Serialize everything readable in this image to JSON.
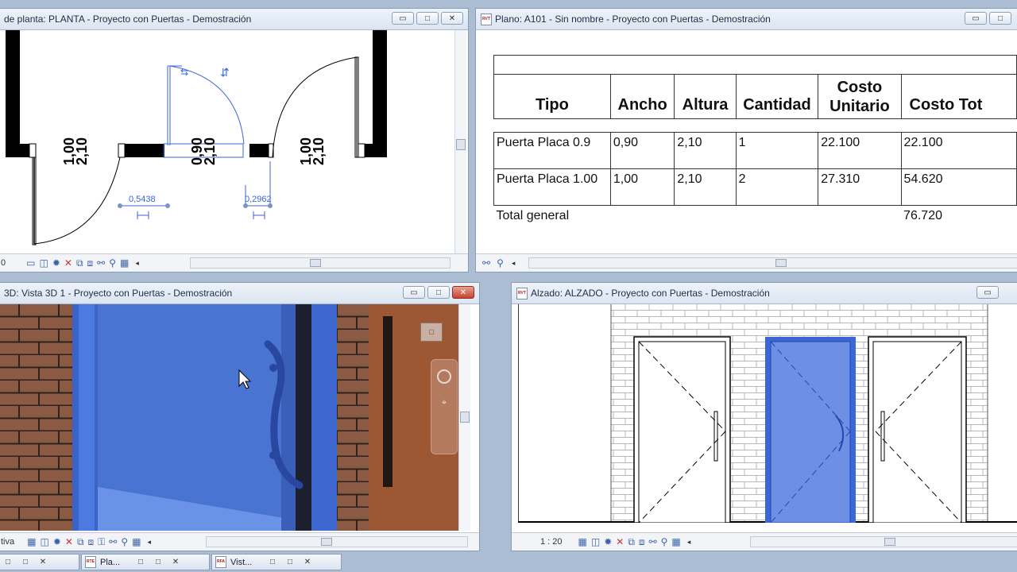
{
  "windows": {
    "planta": {
      "title": "de planta: PLANTA - Proyecto con Puertas - Demostración",
      "dims": {
        "w1": "1,00",
        "h1": "2,10",
        "w2": "0,90",
        "h2": "2,10",
        "w3": "1,00",
        "h3": "2,10",
        "d1": "0,5438",
        "d2": "0,2962"
      },
      "status_scale": "0"
    },
    "plano": {
      "title": "Plano: A101 - Sin nombre - Proyecto con Puertas - Demostración",
      "schedule": {
        "headers": [
          "Tipo",
          "Ancho",
          "Altura",
          "Cantidad",
          "Costo Unitario",
          "Costo Tot"
        ],
        "rows": [
          [
            "Puerta Placa 0.9",
            "0,90",
            "2,10",
            "1",
            "22.100",
            "22.100"
          ],
          [
            "Puerta Placa 1.00",
            "1,00",
            "2,10",
            "2",
            "27.310",
            "54.620"
          ]
        ],
        "total_label": "Total general",
        "total_value": "76.720"
      }
    },
    "vista3d": {
      "title": "3D: Vista 3D 1 - Proyecto con Puertas - Demostración",
      "status_text": "tiva"
    },
    "alzado": {
      "title": "Alzado: ALZADO - Proyecto con Puertas - Demostración",
      "scale": "1 : 20"
    }
  },
  "taskbar": {
    "items": [
      "Pla...",
      "Vist..."
    ]
  },
  "window_buttons": {
    "min": "▭",
    "max": "□",
    "close": "✕"
  },
  "colors": {
    "selection_blue": "#3b66d6",
    "brick": "#8a5a42",
    "background": "#abbdd3"
  }
}
